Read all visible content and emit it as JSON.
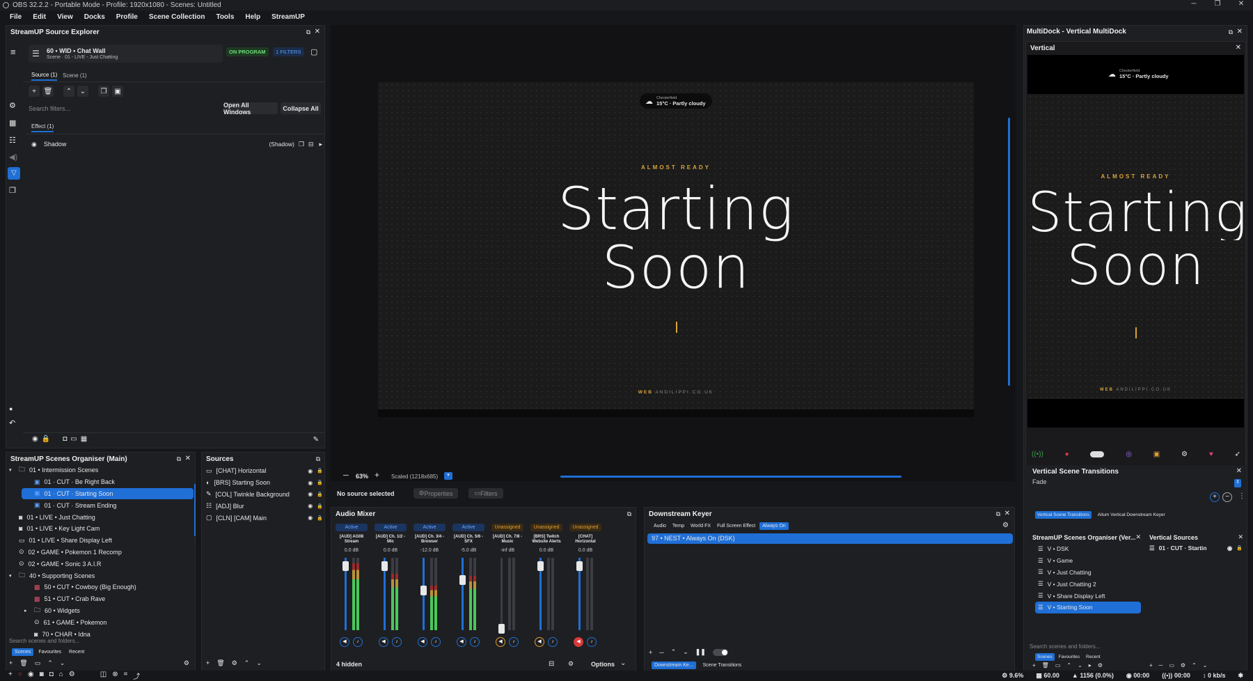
{
  "window": {
    "title": "OBS 32.2.2 - Portable Mode - Profile: 1920x1080 - Scenes: Untitled"
  },
  "menu": [
    "File",
    "Edit",
    "View",
    "Docks",
    "Profile",
    "Scene Collection",
    "Tools",
    "Help",
    "StreamUP"
  ],
  "source_explorer": {
    "title": "StreamUP Source Explorer",
    "source_name": "60 • WID • Chat Wall",
    "source_sub": "Scene · 01 - LIVE - Just Chatting",
    "badge_program": "ON PROGRAM",
    "badge_filters": "1 FILTERS",
    "tabs": [
      "Source (1)",
      "Scene (1)"
    ],
    "search_placeholder": "Search filters...",
    "open_all": "Open All Windows",
    "collapse_all": "Collapse All",
    "section": "Effect (1)",
    "filter_name": "Shadow",
    "filter_tag": "(Shadow)"
  },
  "preview": {
    "weather_city": "Chesterfield",
    "weather_temp": "15°C · Partly cloudy",
    "kicker": "ALMOST READY",
    "line1": "Starting",
    "line2": "Soon",
    "web_label": "WEB",
    "web_url": "ANDILIPPI.CO.UK",
    "zoom": "63%",
    "scaled": "Scaled (1218x685)"
  },
  "source_toolbar": {
    "no_source": "No source selected",
    "properties": "Properties",
    "filters": "Filters"
  },
  "scenes_organiser": {
    "title": "StreamUP Scenes Organiser (Main)",
    "items": [
      {
        "label": "01 • Intermission Scenes",
        "indent": 0,
        "type": "folder"
      },
      {
        "label": "01 · CUT · Be Right Back",
        "indent": 1,
        "type": "scene"
      },
      {
        "label": "01 · CUT · Starting Soon",
        "indent": 1,
        "type": "scene",
        "selected": true
      },
      {
        "label": "01 · CUT · Stream Ending",
        "indent": 1,
        "type": "scene"
      },
      {
        "label": "01 • LIVE • Just Chatting",
        "indent": 0,
        "type": "cam"
      },
      {
        "label": "01 • LIVE • Key Light Cam",
        "indent": 0,
        "type": "cam"
      },
      {
        "label": "01 • LIVE • Share Display Left",
        "indent": 0,
        "type": "display"
      },
      {
        "label": "02 • GAME • Pokemon 1 Recomp",
        "indent": 0,
        "type": "game"
      },
      {
        "label": "02 • GAME • Sonic 3 A.I.R",
        "indent": 0,
        "type": "game"
      },
      {
        "label": "40 • Supporting Scenes",
        "indent": 0,
        "type": "folder"
      },
      {
        "label": "50 • CUT • Cowboy (Big Enough)",
        "indent": 1,
        "type": "red"
      },
      {
        "label": "51 • CUT • Crab Rave",
        "indent": 1,
        "type": "red"
      },
      {
        "label": "60 • Widgets",
        "indent": 1,
        "type": "folder"
      },
      {
        "label": "61 • GAME • Pokemon",
        "indent": 1,
        "type": "game"
      },
      {
        "label": "70 • CHAR • Idna",
        "indent": 1,
        "type": "cam"
      }
    ],
    "search_placeholder": "Search scenes and folders...",
    "tabs": [
      "Scenes",
      "Favourites",
      "Recent"
    ]
  },
  "sources": {
    "title": "Sources",
    "items": [
      "[CHAT] Horizontal",
      "[BRS] Starting Soon",
      "[COL] Twinkle Background",
      "[ADJ] Blur",
      "[CLN] [CAM] Main"
    ]
  },
  "audio_mixer": {
    "title": "Audio Mixer",
    "channels": [
      {
        "status": "Active",
        "name": "[AUD] AG08 Stream",
        "db": "0.0 dB",
        "level": 0.92,
        "fader": 0.95,
        "mute": "normal"
      },
      {
        "status": "Active",
        "name": "[AUD] Ch. 1/2 - Mic",
        "db": "0.0 dB",
        "level": 0.78,
        "fader": 0.95,
        "mute": "normal"
      },
      {
        "status": "Active",
        "name": "[AUD] Ch. 3/4 - Browser",
        "db": "-12.0 dB",
        "level": 0.62,
        "fader": 0.6,
        "mute": "normal"
      },
      {
        "status": "Active",
        "name": "[AUD] Ch. 5/6 - SFX",
        "db": "-5.0 dB",
        "level": 0.75,
        "fader": 0.75,
        "mute": "normal"
      },
      {
        "status": "Unassigned",
        "name": "[AUD] Ch. 7/8 - Music",
        "db": "-inf dB",
        "level": 0.0,
        "fader": 0.05,
        "mute": "orange"
      },
      {
        "status": "Unassigned",
        "name": "[BRS] Twitch Website Alerts",
        "db": "0.0 dB",
        "level": 0.0,
        "fader": 0.95,
        "mute": "orange"
      },
      {
        "status": "Unassigned",
        "name": "[CHAT] Horizontal",
        "db": "0.0 dB",
        "level": 0.0,
        "fader": 0.95,
        "mute": "red"
      }
    ],
    "hidden": "4 hidden",
    "options": "Options"
  },
  "dsk": {
    "title": "Downstream Keyer",
    "tabs": [
      "Audio",
      "Temp",
      "World FX",
      "Full Screen Effect",
      "Always On"
    ],
    "item": "97 • NEST • Always On (DSK)",
    "bottom_tabs": [
      "Downstream Ke...",
      "Scene Transitions"
    ]
  },
  "multidock": {
    "title": "MultiDock - Vertical MultiDock",
    "vertical_title": "Vertical",
    "transitions_title": "Vertical Scene Transitions",
    "transition": "Fade",
    "tabs": [
      "Vertical Scene Transitions",
      "Aitum Vertical Downstream Keyer"
    ],
    "organiser_title": "StreamUP Scenes Organiser (Ver...",
    "organiser_items": [
      "V • DSK",
      "V • Game",
      "V • Just Chatting",
      "V • Just Chatting 2",
      "V • Share Display Left",
      "V • Starting Soon"
    ],
    "organiser_search": "Search scenes and folders...",
    "organiser_tabs": [
      "Scenes",
      "Favourites",
      "Recent"
    ],
    "vsources_title": "Vertical Sources",
    "vsource_item": "01 · CUT · Startin"
  },
  "status": {
    "cpu": "9.6%",
    "fps": "60.00",
    "dropped": "1156 (0.0%)",
    "rec_time": "00:00",
    "stream_time": "00:00",
    "kbps": "0 kb/s"
  },
  "colors": {
    "accent": "#1f6fd6",
    "green": "#3aa04a",
    "gold": "#d9a43a"
  }
}
